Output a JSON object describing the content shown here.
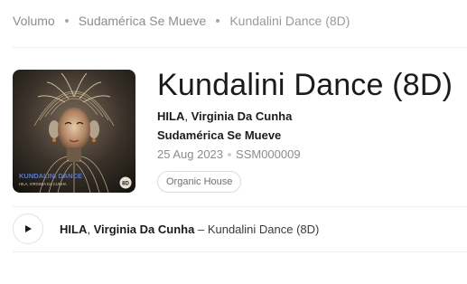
{
  "breadcrumb": {
    "items": [
      "Volumo",
      "Sudamérica Se Mueve",
      "Kundalini Dance (8D)"
    ]
  },
  "release": {
    "title": "Kundalini Dance (8D)",
    "artists": [
      "HILA",
      "Virginia Da Cunha"
    ],
    "artist_separator": ",",
    "label": "Sudamérica Se Mueve",
    "date": "25 Aug 2023",
    "catalog": "SSM000009",
    "genre": "Organic House"
  },
  "cover": {
    "text_title": "KUNDALINI DANCE",
    "text_artists": "HILA, VIRGINIA DA CUNHA",
    "text_corner": "8D"
  },
  "track": {
    "artists": [
      "HILA",
      "Virginia Da Cunha"
    ],
    "artist_separator": ",",
    "dash": "–",
    "name": "Kundalini Dance (8D)"
  },
  "colors": {
    "text": "#1b1b1b",
    "muted": "#8c8c8c",
    "divider": "#ececec",
    "cover_bg": "#2a2520"
  },
  "icons": {
    "play": "play-icon",
    "breadcrumb_separator": "dot-icon"
  }
}
